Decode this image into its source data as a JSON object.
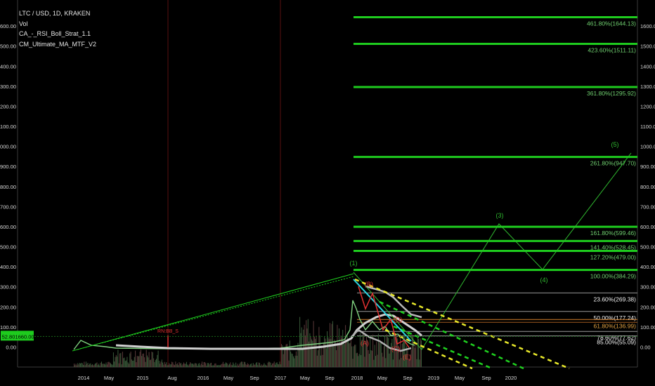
{
  "header": {
    "symbol": "LTC / USD, 1D, KRAKEN",
    "indicators": [
      "Vol",
      "CA_-_RSI_Boll_Strat_1.1",
      "CM_Ultimate_MA_MTF_V2"
    ]
  },
  "price_badge": {
    "left": "52.80",
    "right": "1660.00"
  },
  "colors": {
    "fib": "#1ecb1e",
    "fib_text": "#6fcf6f",
    "white_line": "#d0d0d0",
    "yellow": "#e8e82a",
    "green_dash": "#1fd11f",
    "cyan": "#2ad4e0",
    "red": "#e03030",
    "orange": "#d4802a"
  },
  "chart_data": {
    "type": "line",
    "title": "LTC / USD, 1D, KRAKEN",
    "ylim": [
      -100,
      1660
    ],
    "y_ticks": [
      "0.00",
      "100.00",
      "200.00",
      "300.00",
      "400.00",
      "500.00",
      "600.00",
      "700.00",
      "800.00",
      "900.00",
      "1000.00",
      "1100.00",
      "1200.00",
      "1300.00",
      "1400.00",
      "1500.00",
      "1600.00"
    ],
    "x_ticks": [
      "2014",
      "May",
      "2015",
      "Aug",
      "2016",
      "May",
      "Sep",
      "2017",
      "May",
      "Sep",
      "2018",
      "May",
      "Sep",
      "2019",
      "May",
      "Sep",
      "2020"
    ],
    "fib_levels": [
      {
        "label": "461.80%(1644.13)",
        "value": 1644.13,
        "color": "green"
      },
      {
        "label": "423.60%(1511.11)",
        "value": 1511.11,
        "color": "green"
      },
      {
        "label": "361.80%(1295.92)",
        "value": 1295.92,
        "color": "green"
      },
      {
        "label": "261.80%(947.70)",
        "value": 947.7,
        "color": "green"
      },
      {
        "label": "161.80%(599.46)",
        "value": 599.46,
        "color": "green"
      },
      {
        "label": "141.40%(528.45)",
        "value": 528.45,
        "color": "green"
      },
      {
        "label": "127.20%(479.00)",
        "value": 479.0,
        "color": "green"
      },
      {
        "label": "100.00%(384.29)",
        "value": 384.29,
        "color": "green"
      },
      {
        "label": "23.60%(269.38)",
        "value": 269.38,
        "color": "white"
      },
      {
        "label": "50.00%(177.24)",
        "value": 177.24,
        "color": "white"
      },
      {
        "label": "61.80%(136.99)",
        "value": 136.99,
        "color": "orange"
      },
      {
        "label": "78.60%(77.62)",
        "value": 77.62,
        "color": "white"
      },
      {
        "label": "85.00%(55.09)",
        "value": 55.09,
        "color": "white"
      }
    ],
    "wave_labels": [
      "(1)",
      "(3)",
      "(4)",
      "(5)",
      "(B)",
      "(C)",
      "(A)",
      "(E)",
      "(D)"
    ],
    "annotations": [
      "RN:BB_S"
    ]
  }
}
